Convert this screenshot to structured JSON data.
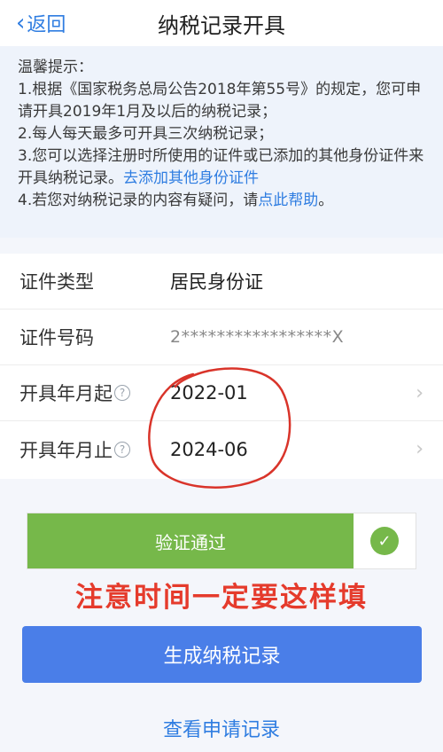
{
  "header": {
    "back_label": "返回",
    "title": "纳税记录开具"
  },
  "tips": {
    "heading": "温馨提示：",
    "line1": "1.根据《国家税务总局公告2018年第55号》的规定，您可申请开具2019年1月及以后的纳税记录；",
    "line2": "2.每人每天最多可开具三次纳税记录；",
    "line3_text": "3.您可以选择注册时所使用的证件或已添加的其他身份证件来开具纳税记录。",
    "line3_link": "去添加其他身份证件",
    "line4_text": "4.若您对纳税记录的内容有疑问，请",
    "line4_link": "点此帮助",
    "line4_end": "。"
  },
  "form": {
    "id_type_label": "证件类型",
    "id_type_value": "居民身份证",
    "id_number_label": "证件号码",
    "id_number_value": "2*****************X",
    "start_label": "开具年月起",
    "start_value": "2022-01",
    "end_label": "开具年月止",
    "end_value": "2024-06"
  },
  "verify": {
    "label": "验证通过"
  },
  "annotation": "注意时间一定要这样填",
  "actions": {
    "generate_label": "生成纳税记录",
    "view_records_label": "查看申请记录"
  },
  "colors": {
    "accent": "#2f7de1",
    "success": "#76b84a",
    "primary_button": "#4a7ee8",
    "annotation": "#e53b2c"
  }
}
